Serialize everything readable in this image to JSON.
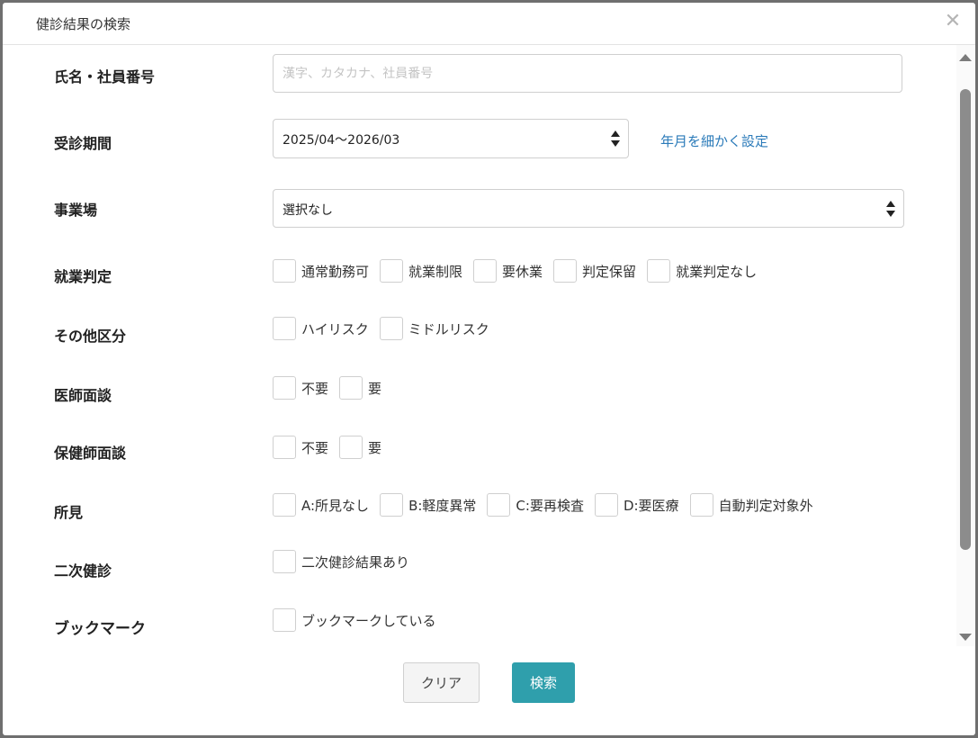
{
  "dialog": {
    "title": "健診結果の検索",
    "close_icon": "close-icon"
  },
  "form": {
    "name": {
      "label": "氏名・社員番号",
      "placeholder": "漢字、カタカナ、社員番号",
      "value": ""
    },
    "period": {
      "label": "受診期間",
      "value": "2025/04〜2026/03",
      "link": "年月を細かく設定"
    },
    "site": {
      "label": "事業場",
      "value": "選択なし"
    },
    "work_judgement": {
      "label": "就業判定",
      "options": [
        "通常勤務可",
        "就業制限",
        "要休業",
        "判定保留",
        "就業判定なし"
      ]
    },
    "other": {
      "label": "その他区分",
      "options": [
        "ハイリスク",
        "ミドルリスク"
      ]
    },
    "doctor_interview": {
      "label": "医師面談",
      "options": [
        "不要",
        "要"
      ]
    },
    "nurse_interview": {
      "label": "保健師面談",
      "options": [
        "不要",
        "要"
      ]
    },
    "findings": {
      "label": "所見",
      "options": [
        "A:所見なし",
        "B:軽度異常",
        "C:要再検査",
        "D:要医療",
        "自動判定対象外"
      ]
    },
    "secondary": {
      "label": "二次健診",
      "options": [
        "二次健診結果あり"
      ]
    },
    "bookmark": {
      "label": "ブックマーク",
      "options": [
        "ブックマークしている"
      ]
    }
  },
  "footer": {
    "clear_label": "クリア",
    "search_label": "検索"
  },
  "colors": {
    "primary": "#2f9fac",
    "link": "#2a7ab9"
  }
}
